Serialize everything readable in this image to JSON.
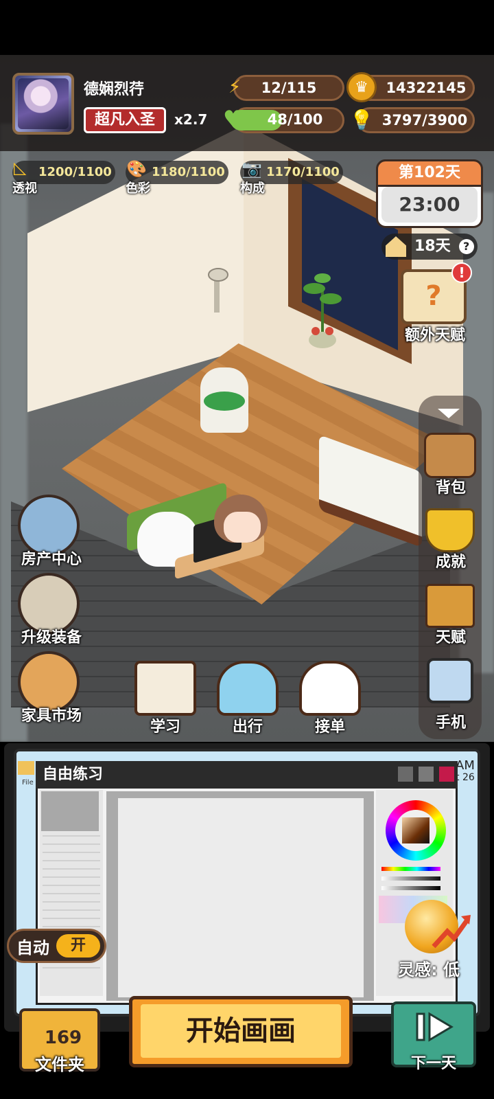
{
  "player": {
    "name": "德娴烈荇",
    "rank": "超凡入圣",
    "multiplier": "x2.7"
  },
  "resources": {
    "energy": "12/115",
    "coins": "14322145",
    "health": "48/100",
    "health_fraction": 0.48,
    "ideas": "3797/3900"
  },
  "skills": [
    {
      "label": "透视",
      "value": "1200/1100"
    },
    {
      "label": "色彩",
      "value": "1180/1100"
    },
    {
      "label": "构成",
      "value": "1170/1100"
    }
  ],
  "calendar": {
    "day": "第102天",
    "time": "23:00",
    "countdown": "18天"
  },
  "talent_popup": {
    "label": "额外天赋"
  },
  "left_menu": [
    {
      "label": "房产中心"
    },
    {
      "label": "升级装备"
    },
    {
      "label": "家具市场"
    }
  ],
  "right_menu": [
    {
      "label": "背包"
    },
    {
      "label": "成就"
    },
    {
      "label": "天赋"
    },
    {
      "label": "手机"
    }
  ],
  "actions": [
    {
      "label": "学习"
    },
    {
      "label": "出行"
    },
    {
      "label": "接单"
    }
  ],
  "painting_app": {
    "title": "自由练习",
    "file_label": "File",
    "corner_text_1": "AM",
    "corner_text_2": "t 26"
  },
  "auto": {
    "label": "自动",
    "state": "开"
  },
  "inspiration": {
    "label": "灵感: 低"
  },
  "folder": {
    "count": "169",
    "label": "文件夹"
  },
  "start_button": {
    "label": "开始画画"
  },
  "next_day": {
    "label": "下一天"
  },
  "colors": {
    "accent": "#f59c2a",
    "health": "#7fc64a",
    "rank_bg": "#b32c2c",
    "next_bg": "#3fa58a"
  }
}
